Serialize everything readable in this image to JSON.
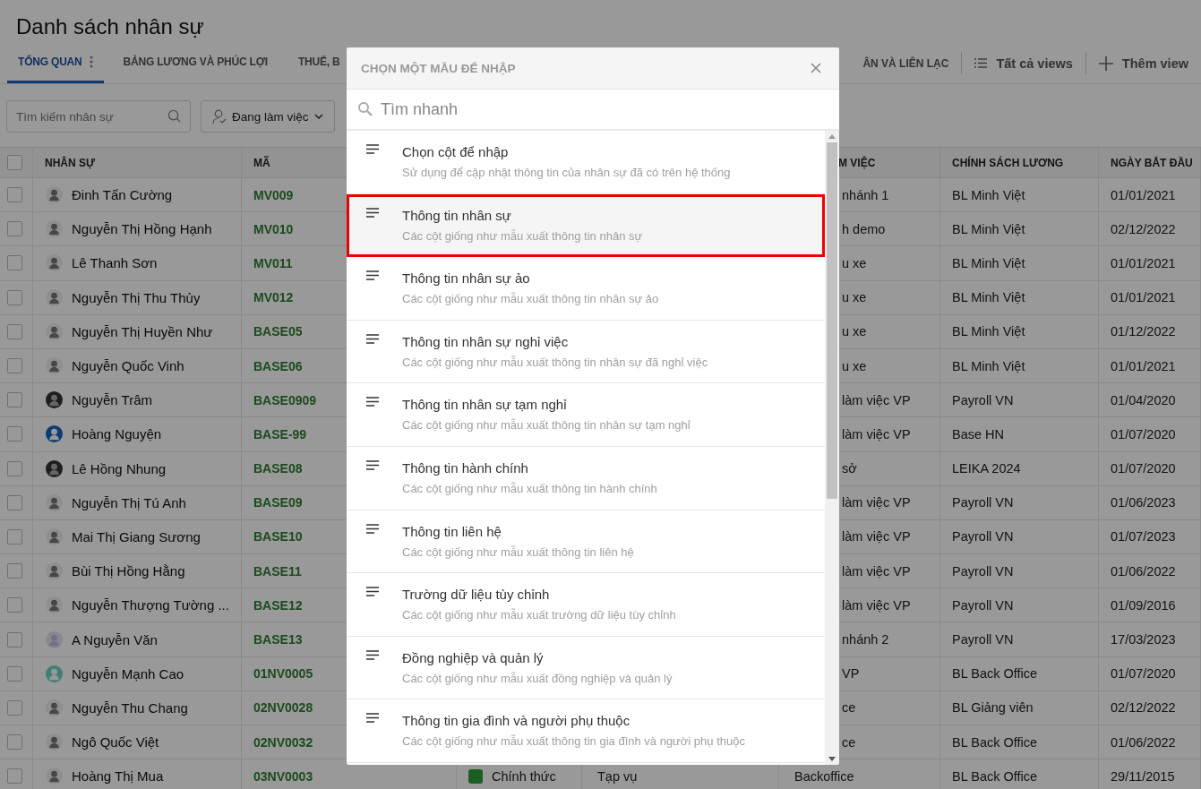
{
  "page_title": "Danh sách nhân sự",
  "tabs": [
    {
      "label": "TỔNG QUAN",
      "selected": true
    },
    {
      "label": "BẢNG LƯƠNG VÀ PHÚC LỢI",
      "selected": false
    },
    {
      "label": "THUẾ, B",
      "selected": false
    }
  ],
  "right_tabs": [
    {
      "label": "ÂN VÀ LIÊN LẠC",
      "kind": "tab"
    },
    {
      "label": "Tất cả views",
      "kind": "views"
    },
    {
      "label": "Thêm view",
      "kind": "add"
    }
  ],
  "search": {
    "placeholder": "Tìm kiếm nhân sự"
  },
  "status_filter": {
    "label": "Đang làm việc"
  },
  "table": {
    "all_checked": false,
    "columns": {
      "name": "NHÂN SỰ",
      "code": "MÃ",
      "column_5": "M VIỆC",
      "salary": "CHÍNH SÁCH LƯƠNG",
      "start_date": "NGÀY BẮT ĐẦU"
    },
    "rows": [
      {
        "checked": false,
        "kind": "default",
        "name": "Đinh Tấn Cường",
        "code": "MV009",
        "column_5": "nhánh 1",
        "salary": "BL Minh Việt",
        "start_date": "01/01/2021"
      },
      {
        "checked": false,
        "kind": "default",
        "name": "Nguyễn Thị Hồng Hạnh",
        "code": "MV010",
        "column_5": "h demo",
        "salary": "BL Minh Việt",
        "start_date": "02/12/2022"
      },
      {
        "checked": false,
        "kind": "default",
        "name": "Lê Thanh Sơn",
        "code": "MV011",
        "column_5": "u xe",
        "salary": "BL Minh Việt",
        "start_date": "01/01/2021"
      },
      {
        "checked": false,
        "kind": "default",
        "name": "Nguyễn Thị Thu Thủy",
        "code": "MV012",
        "column_5": "u xe",
        "salary": "BL Minh Việt",
        "start_date": "01/01/2021"
      },
      {
        "checked": false,
        "kind": "default",
        "name": "Nguyễn Thị Huyền Như",
        "code": "BASE05",
        "column_5": "u xe",
        "salary": "BL Minh Việt",
        "start_date": "01/12/2022"
      },
      {
        "checked": false,
        "kind": "default",
        "name": "Nguyễn Quốc Vinh",
        "code": "BASE06",
        "column_5": "u xe",
        "salary": "BL Minh Việt",
        "start_date": "01/01/2021"
      },
      {
        "checked": false,
        "kind": "photo",
        "name": "Nguyễn Trâm",
        "code": "BASE0909",
        "column_5": "làm việc VP",
        "salary": "Payroll VN",
        "start_date": "01/04/2020"
      },
      {
        "checked": false,
        "kind": "brand",
        "name": "Hoàng Nguyện",
        "code": "BASE-99",
        "column_5": "làm việc VP",
        "salary": "Base HN",
        "start_date": "01/07/2020"
      },
      {
        "checked": false,
        "kind": "photo",
        "name": "Lê Hồng Nhung",
        "code": "BASE08",
        "column_5": "sở",
        "salary": "LEIKA 2024",
        "start_date": "01/07/2020"
      },
      {
        "checked": false,
        "kind": "default",
        "name": "Nguyễn Thị Tú Anh",
        "code": "BASE09",
        "column_5": "làm việc VP",
        "salary": "Payroll VN",
        "start_date": "01/06/2023"
      },
      {
        "checked": false,
        "kind": "default",
        "name": "Mai Thị Giang Sương",
        "code": "BASE10",
        "column_5": "làm việc VP",
        "salary": "Payroll VN",
        "start_date": "01/07/2023"
      },
      {
        "checked": false,
        "kind": "default",
        "name": "Bùi Thị Hồng Hằng",
        "code": "BASE11",
        "column_5": "làm việc VP",
        "salary": "Payroll VN",
        "start_date": "01/06/2022"
      },
      {
        "checked": false,
        "kind": "default",
        "name": "Nguyễn Thượng Tường ...",
        "code": "BASE12",
        "column_5": "làm việc VP",
        "salary": "Payroll VN",
        "start_date": "01/09/2016"
      },
      {
        "checked": false,
        "kind": "light",
        "name": "A Nguyễn Văn",
        "code": "BASE13",
        "column_5": "nhánh 2",
        "salary": "Payroll VN",
        "start_date": "17/03/2023"
      },
      {
        "checked": false,
        "kind": "teal",
        "name": "Nguyễn Mạnh Cao",
        "code": "01NV0005",
        "column_5": "VP",
        "salary": "BL Back Office",
        "start_date": "01/07/2020"
      },
      {
        "checked": false,
        "kind": "default",
        "name": "Nguyễn Thu Chang",
        "code": "02NV0028",
        "column_5": "ce",
        "salary": "BL Giảng viên",
        "start_date": "02/12/2022"
      },
      {
        "checked": false,
        "kind": "default",
        "name": "Ngô Quốc Việt",
        "code": "02NV0032",
        "column_5": "ce",
        "salary": "BL Back Office",
        "start_date": "01/06/2022"
      },
      {
        "checked": false,
        "kind": "default",
        "name": "Hoàng Thị Mua",
        "code": "03NV0003",
        "column_3": "Chính thức",
        "column_4": "Tạp vụ",
        "column_5": "Backoffice",
        "salary": "BL Back Office",
        "start_date": "29/11/2015"
      }
    ]
  },
  "dialog": {
    "title": "CHỌN MỘT MẪU ĐỂ NHẬP",
    "search_placeholder": "Tìm nhanh",
    "items": [
      {
        "title": "Chọn cột để nhập",
        "subtitle": "Sử dụng để cập nhật thông tin của nhân sự đã có trên hệ thống",
        "selected": false
      },
      {
        "title": "Thông tin nhân sự",
        "subtitle": "Các cột giống như mẫu xuất thông tin nhân sự",
        "selected": true
      },
      {
        "title": "Thông tin nhân sự ảo",
        "subtitle": "Các cột giống như mẫu xuất thông tin nhân sự ảo",
        "selected": false
      },
      {
        "title": "Thông tin nhân sự nghỉ việc",
        "subtitle": "Các cột giống như mẫu xuất thông tin nhân sự đã nghỉ việc",
        "selected": false
      },
      {
        "title": "Thông tin nhân sự tạm nghỉ",
        "subtitle": "Các cột giống như mẫu xuất thông tin nhân sự tạm nghỉ",
        "selected": false
      },
      {
        "title": "Thông tin hành chính",
        "subtitle": "Các cột giống như mẫu xuất thông tin hành chính",
        "selected": false
      },
      {
        "title": "Thông tin liên hệ",
        "subtitle": "Các cột giống như mẫu xuất thông tin liên hệ",
        "selected": false
      },
      {
        "title": "Trường dữ liệu tùy chỉnh",
        "subtitle": "Các cột giống như mẫu xuất trường dữ liệu tùy chỉnh",
        "selected": false
      },
      {
        "title": "Đồng nghiệp và quản lý",
        "subtitle": "Các cột giống như mẫu xuất đồng nghiệp và quản lý",
        "selected": false
      },
      {
        "title": "Thông tin gia đình và người phụ thuộc",
        "subtitle": "Các cột giống như mẫu xuất thông tin gia đình và người phụ thuộc",
        "selected": false
      }
    ]
  }
}
